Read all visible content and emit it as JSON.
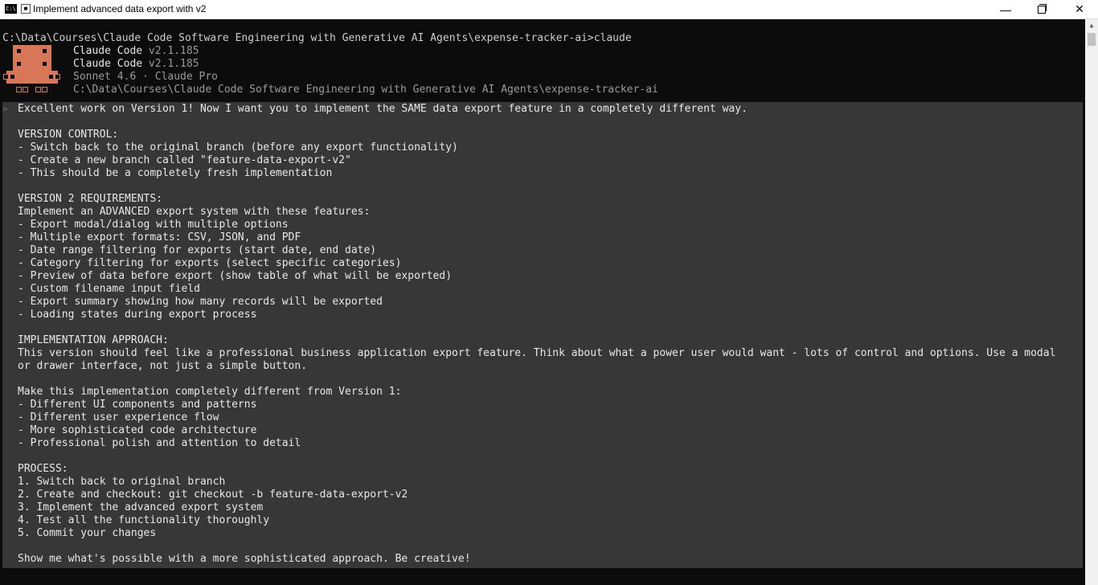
{
  "window": {
    "app_icon_text": "C:\\",
    "title": "Implement advanced data export with v2",
    "minimize_glyph": "—",
    "close_glyph": "✕"
  },
  "terminal": {
    "command_line": "C:\\Data\\Courses\\Claude Code Software Engineering with Generative AI Agents\\expense-tracker-ai>claude",
    "header": {
      "line1_name": "Claude Code",
      "line1_version": "v2.1.185",
      "line2_name": "Claude Code",
      "line2_version": "v2.1.185",
      "model_plan": "Sonnet 4.6 · Claude Pro",
      "cwd": "C:\\Data\\Courses\\Claude Code Software Engineering with Generative AI Agents\\expense-tracker-ai"
    },
    "accent_color": "#d77757",
    "message_lines": [
      "Excellent work on Version 1! Now I want you to implement the SAME data export feature in a completely different way.",
      "",
      "VERSION CONTROL:",
      "- Switch back to the original branch (before any export functionality)",
      "- Create a new branch called \"feature-data-export-v2\"",
      "- This should be a completely fresh implementation",
      "",
      "VERSION 2 REQUIREMENTS:",
      "Implement an ADVANCED export system with these features:",
      "- Export modal/dialog with multiple options",
      "- Multiple export formats: CSV, JSON, and PDF",
      "- Date range filtering for exports (start date, end date)",
      "- Category filtering for exports (select specific categories)",
      "- Preview of data before export (show table of what will be exported)",
      "- Custom filename input field",
      "- Export summary showing how many records will be exported",
      "- Loading states during export process",
      "",
      "IMPLEMENTATION APPROACH:",
      "This version should feel like a professional business application export feature. Think about what a power user would want - lots of control and options. Use a modal",
      "or drawer interface, not just a simple button.",
      "",
      "Make this implementation completely different from Version 1:",
      "- Different UI components and patterns",
      "- Different user experience flow",
      "- More sophisticated code architecture",
      "- Professional polish and attention to detail",
      "",
      "PROCESS:",
      "1. Switch back to original branch",
      "2. Create and checkout: git checkout -b feature-data-export-v2",
      "3. Implement the advanced export system",
      "4. Test all the functionality thoroughly",
      "5. Commit your changes",
      "",
      "Show me what's possible with a more sophisticated approach. Be creative!"
    ]
  }
}
